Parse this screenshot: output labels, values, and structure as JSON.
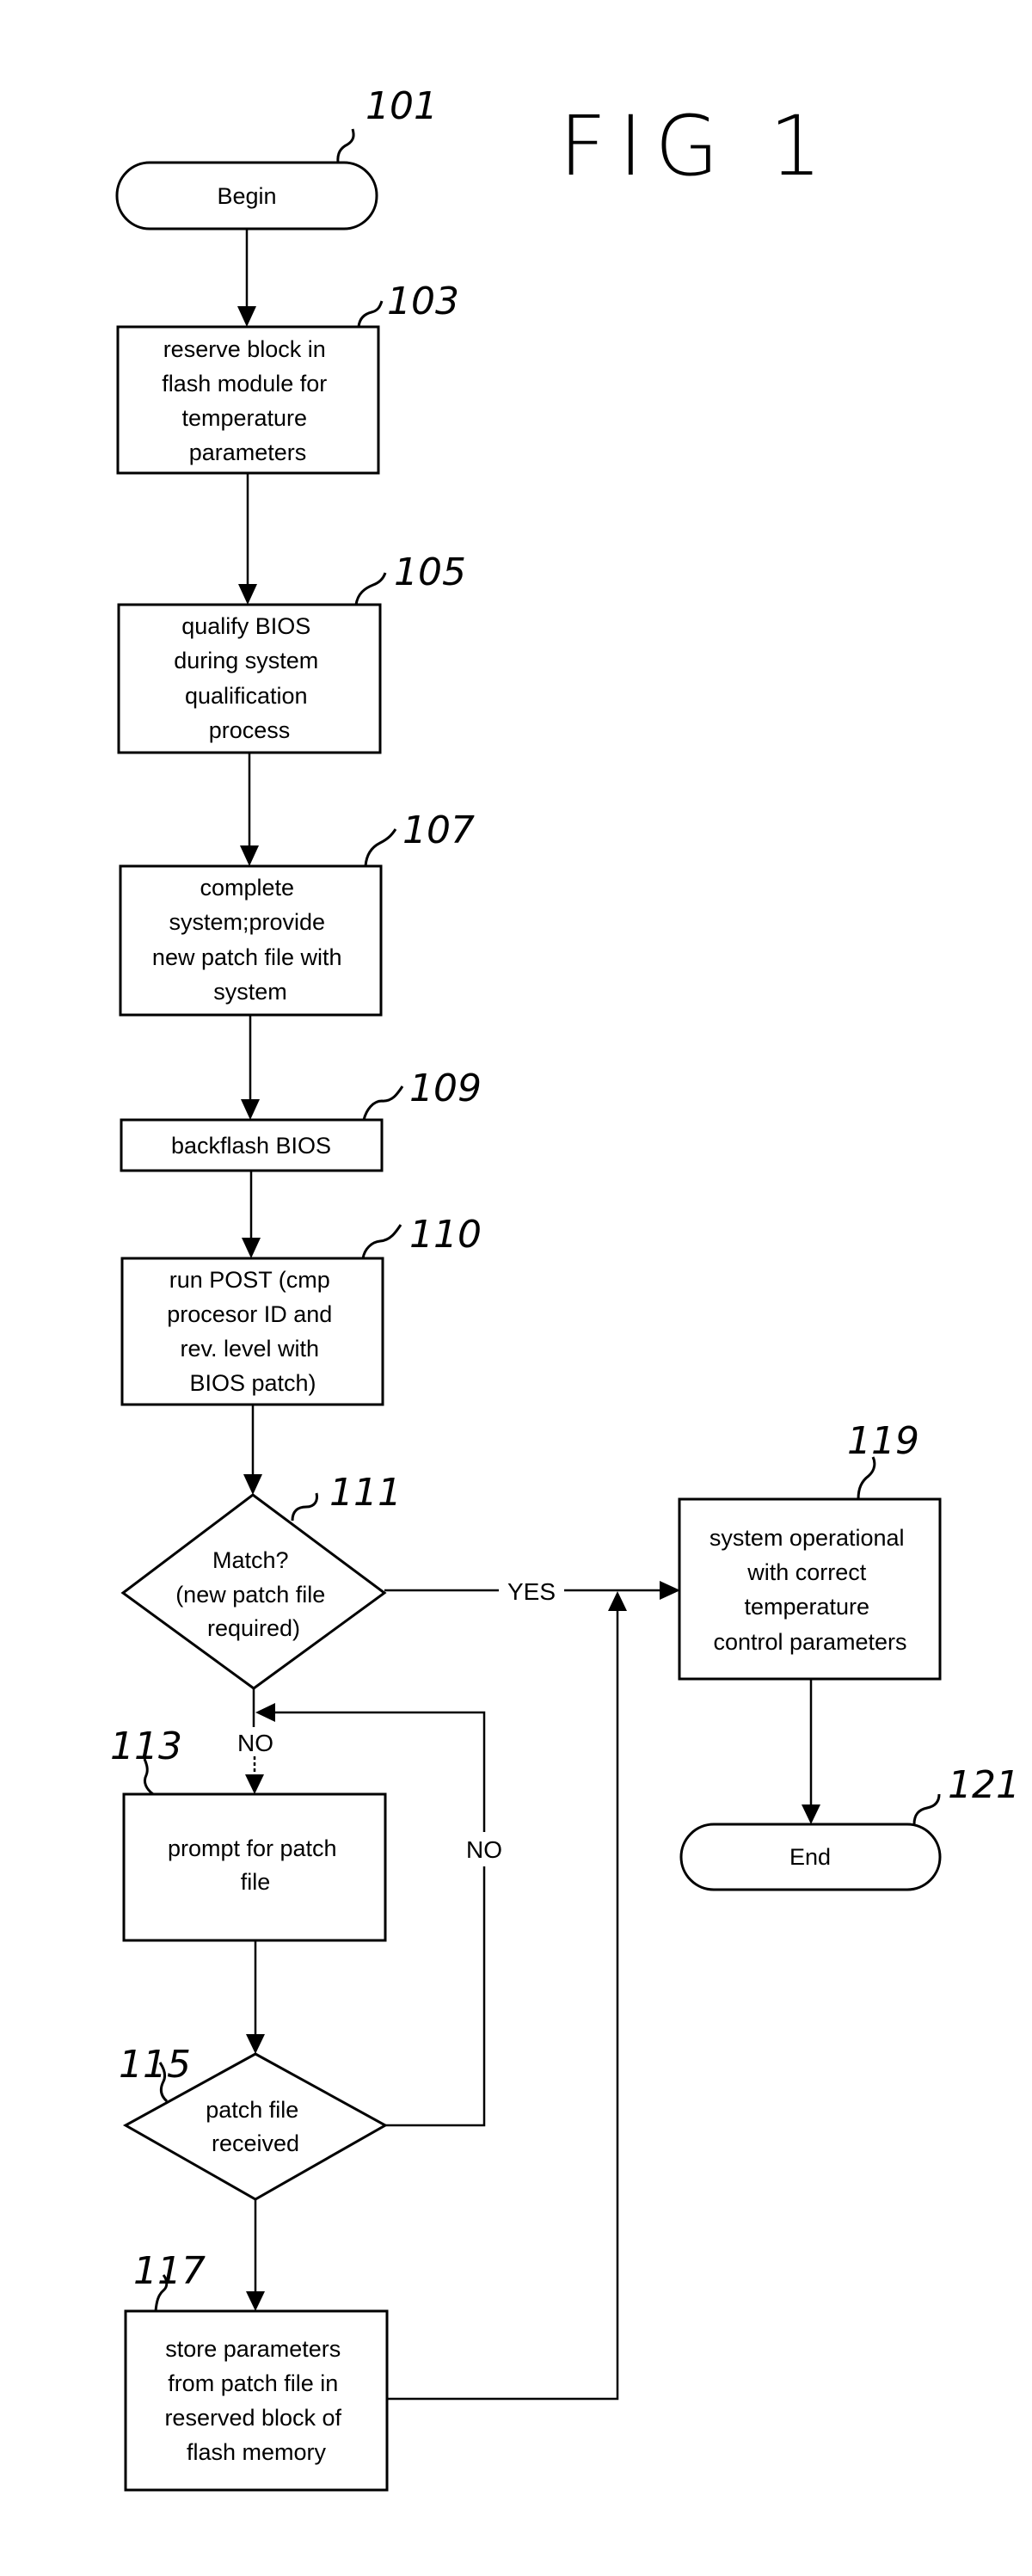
{
  "figure": {
    "title": "FIG 1"
  },
  "nodes": [
    {
      "id": "101",
      "ref": "101",
      "type": "terminal",
      "lines": [
        "Begin"
      ]
    },
    {
      "id": "103",
      "ref": "103",
      "type": "process",
      "lines": [
        "reserve block in",
        "flash module for",
        "temperature",
        "parameters"
      ]
    },
    {
      "id": "105",
      "ref": "105",
      "type": "process",
      "lines": [
        "qualify BIOS",
        "during system",
        "qualification",
        "process"
      ]
    },
    {
      "id": "107",
      "ref": "107",
      "type": "process",
      "lines": [
        "complete",
        "system;provide",
        "new patch file with",
        "system"
      ]
    },
    {
      "id": "109",
      "ref": "109",
      "type": "process",
      "lines": [
        "backflash BIOS"
      ]
    },
    {
      "id": "110",
      "ref": "110",
      "type": "process",
      "lines": [
        "run POST (cmp",
        "procesor ID and",
        "rev. level with",
        "BIOS patch)"
      ]
    },
    {
      "id": "111",
      "ref": "111",
      "type": "decision",
      "lines": [
        "Match?",
        "(new patch file",
        "required)"
      ]
    },
    {
      "id": "113",
      "ref": "113",
      "type": "process",
      "lines": [
        "prompt for patch",
        "file"
      ]
    },
    {
      "id": "115",
      "ref": "115",
      "type": "decision",
      "lines": [
        "patch file",
        "received"
      ]
    },
    {
      "id": "117",
      "ref": "117",
      "type": "process",
      "lines": [
        "store parameters",
        "from patch file in",
        "reserved block of",
        "flash memory"
      ]
    },
    {
      "id": "119",
      "ref": "119",
      "type": "process",
      "lines": [
        "system operational",
        "with correct",
        "temperature",
        "control parameters"
      ]
    },
    {
      "id": "121",
      "ref": "121",
      "type": "terminal",
      "lines": [
        "End"
      ]
    }
  ],
  "edges": [
    {
      "from": "101",
      "to": "103",
      "label": ""
    },
    {
      "from": "103",
      "to": "105",
      "label": ""
    },
    {
      "from": "105",
      "to": "107",
      "label": ""
    },
    {
      "from": "107",
      "to": "109",
      "label": ""
    },
    {
      "from": "109",
      "to": "110",
      "label": ""
    },
    {
      "from": "110",
      "to": "111",
      "label": ""
    },
    {
      "from": "111",
      "to": "119",
      "label": "YES"
    },
    {
      "from": "111",
      "to": "113",
      "label": "NO"
    },
    {
      "from": "113",
      "to": "115",
      "label": ""
    },
    {
      "from": "115",
      "to": "113",
      "label": "NO"
    },
    {
      "from": "115",
      "to": "117",
      "label": ""
    },
    {
      "from": "117",
      "to": "119",
      "label": ""
    },
    {
      "from": "119",
      "to": "121",
      "label": ""
    }
  ],
  "edge_labels": {
    "yes": "YES",
    "no_main": "NO",
    "no_loop": "NO"
  }
}
